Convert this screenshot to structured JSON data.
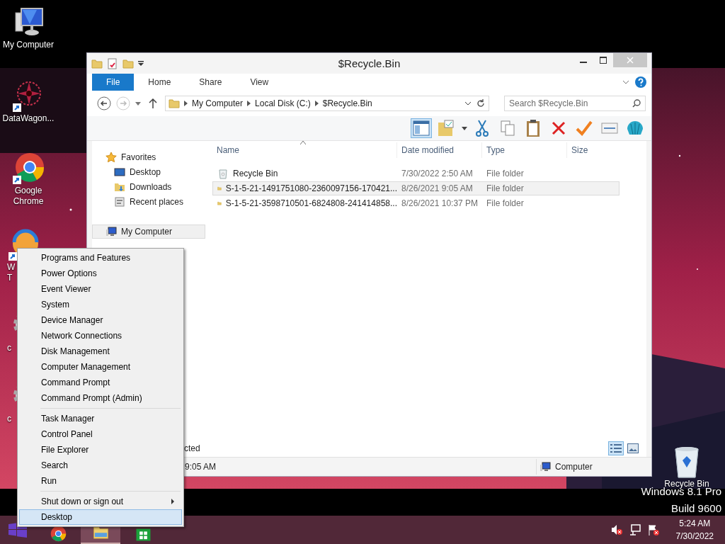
{
  "desktop_icons": [
    {
      "kind": "computer",
      "label": [
        "My Computer"
      ]
    },
    {
      "kind": "ornament",
      "label": [
        "DataWagon..."
      ]
    },
    {
      "kind": "chrome",
      "label": [
        "Google",
        "Chrome"
      ]
    },
    {
      "kind": "swirl",
      "label": [
        "W",
        "T"
      ]
    },
    {
      "kind": "gear",
      "label": [
        "c"
      ]
    },
    {
      "kind": "gear",
      "label": [
        "c"
      ]
    },
    {
      "kind": "bin",
      "label": [
        "Recycle Bin"
      ]
    }
  ],
  "watermark": [
    "Windows 8.1 Pro",
    "Build 9600"
  ],
  "window": {
    "title": "$Recycle.Bin",
    "ribbon_tabs": [
      {
        "label": "File",
        "selected": true
      },
      {
        "label": "Home",
        "selected": false
      },
      {
        "label": "Share",
        "selected": false
      },
      {
        "label": "View",
        "selected": false
      }
    ],
    "address": [
      "My Computer",
      "Local Disk (C:)",
      "$Recycle.Bin"
    ],
    "search": {
      "placeholder": "Search $Recycle.Bin"
    },
    "nav": [
      {
        "label": "Favorites",
        "kind": "star",
        "selected": false,
        "children": [
          {
            "label": "Desktop",
            "kind": "desktop",
            "selected": false
          },
          {
            "label": "Downloads",
            "kind": "downloads",
            "selected": false
          },
          {
            "label": "Recent places",
            "kind": "recent",
            "selected": false
          }
        ]
      },
      {
        "label": "My Computer",
        "kind": "computer",
        "selected": true
      }
    ],
    "columns": [
      "Name",
      "Date modified",
      "Type",
      "Size"
    ],
    "rows": [
      {
        "name": "Recycle Bin",
        "date": "7/30/2022 2:50 AM",
        "type": "File folder",
        "kind": "bin",
        "selected": false
      },
      {
        "name": "S-1-5-21-1491751080-2360097156-170421...",
        "date": "8/26/2021 9:05 AM",
        "type": "File folder",
        "kind": "folder",
        "selected": true
      },
      {
        "name": "S-1-5-21-3598710501-6824808-241414858...",
        "date": "8/26/2021 10:37 PM",
        "type": "File folder",
        "kind": "folder",
        "selected": false
      }
    ],
    "status": {
      "selection": "cted",
      "details": "9:05 AM",
      "location": "Computer"
    },
    "view_buttons": [
      {
        "kind": "details",
        "selected": true
      },
      {
        "kind": "large",
        "selected": false
      }
    ]
  },
  "context_menu": [
    {
      "kind": "item",
      "label": "Programs and Features",
      "selected": false
    },
    {
      "kind": "item",
      "label": "Power Options",
      "selected": false
    },
    {
      "kind": "item",
      "label": "Event Viewer",
      "selected": false
    },
    {
      "kind": "item",
      "label": "System",
      "selected": false
    },
    {
      "kind": "item",
      "label": "Device Manager",
      "selected": false
    },
    {
      "kind": "item",
      "label": "Network Connections",
      "selected": false
    },
    {
      "kind": "item",
      "label": "Disk Management",
      "selected": false
    },
    {
      "kind": "item",
      "label": "Computer Management",
      "selected": false
    },
    {
      "kind": "item",
      "label": "Command Prompt",
      "selected": false
    },
    {
      "kind": "item",
      "label": "Command Prompt (Admin)",
      "selected": false
    },
    {
      "kind": "separator"
    },
    {
      "kind": "item",
      "label": "Task Manager",
      "selected": false
    },
    {
      "kind": "item",
      "label": "Control Panel",
      "selected": false
    },
    {
      "kind": "item",
      "label": "File Explorer",
      "selected": false
    },
    {
      "kind": "item",
      "label": "Search",
      "selected": false
    },
    {
      "kind": "item",
      "label": "Run",
      "selected": false
    },
    {
      "kind": "separator"
    },
    {
      "kind": "submenu",
      "label": "Shut down or sign out",
      "selected": false
    },
    {
      "kind": "item",
      "label": "Desktop",
      "selected": true
    }
  ],
  "taskbar": {
    "apps": [
      {
        "kind": "chrome",
        "selected": false
      },
      {
        "kind": "explorer",
        "selected": true
      },
      {
        "kind": "store",
        "selected": false
      }
    ],
    "clock": {
      "time": "5:24 AM",
      "date": "7/30/2022"
    }
  }
}
